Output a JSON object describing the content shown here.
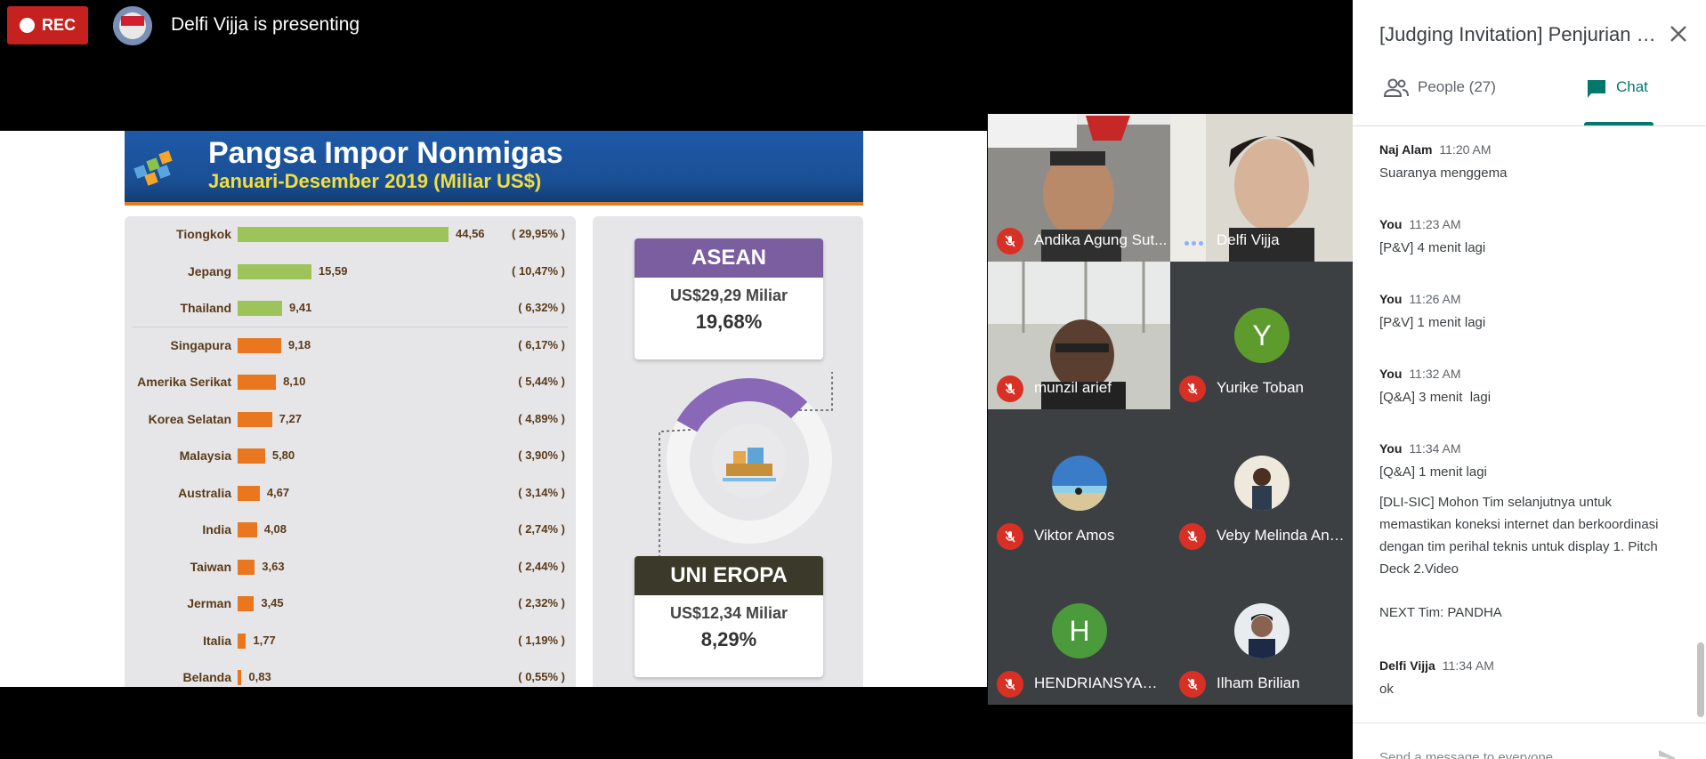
{
  "top_bar": {
    "rec_label": "REC",
    "presenter_text": "Delfi Vijja is presenting"
  },
  "slide": {
    "title": "Pangsa Impor Nonmigas",
    "subtitle": "Januari-Desember 2019 (Miliar US$)",
    "rows": [
      {
        "country": "Tiongkok",
        "value": "44,56",
        "pct": "( 29,95% )",
        "amount": 44.56,
        "color": "#9dc45a"
      },
      {
        "country": "Jepang",
        "value": "15,59",
        "pct": "( 10,47% )",
        "amount": 15.59,
        "color": "#9dc45a"
      },
      {
        "country": "Thailand",
        "value": "9,41",
        "pct": "( 6,32% )",
        "amount": 9.41,
        "color": "#9dc45a"
      },
      {
        "country": "Singapura",
        "value": "9,18",
        "pct": "( 6,17% )",
        "amount": 9.18,
        "color": "#e8771f"
      },
      {
        "country": "Amerika Serikat",
        "value": "8,10",
        "pct": "( 5,44% )",
        "amount": 8.1,
        "color": "#e8771f"
      },
      {
        "country": "Korea Selatan",
        "value": "7,27",
        "pct": "( 4,89% )",
        "amount": 7.27,
        "color": "#e8771f"
      },
      {
        "country": "Malaysia",
        "value": "5,80",
        "pct": "( 3,90% )",
        "amount": 5.8,
        "color": "#e8771f"
      },
      {
        "country": "Australia",
        "value": "4,67",
        "pct": "( 3,14% )",
        "amount": 4.67,
        "color": "#e8771f"
      },
      {
        "country": "India",
        "value": "4,08",
        "pct": "( 2,74% )",
        "amount": 4.08,
        "color": "#e8771f"
      },
      {
        "country": "Taiwan",
        "value": "3,63",
        "pct": "( 2,44% )",
        "amount": 3.63,
        "color": "#e8771f"
      },
      {
        "country": "Jerman",
        "value": "3,45",
        "pct": "( 2,32% )",
        "amount": 3.45,
        "color": "#e8771f"
      },
      {
        "country": "Italia",
        "value": "1,77",
        "pct": "( 1,19% )",
        "amount": 1.77,
        "color": "#e8771f"
      },
      {
        "country": "Belanda",
        "value": "0,83",
        "pct": "( 0,55% )",
        "amount": 0.83,
        "color": "#e8771f"
      }
    ],
    "asean": {
      "label": "ASEAN",
      "amount": "US$29,29 Miliar",
      "pct": "19,68%",
      "color": "#7b5ea0"
    },
    "eu": {
      "label": "UNI EROPA",
      "amount": "US$12,34 Miliar",
      "pct": "8,29%",
      "color": "#3b3a2a"
    }
  },
  "participants": [
    {
      "name": "Andika Agung Sut...",
      "muted": true,
      "kind": "video"
    },
    {
      "name": "Delfi Vijja",
      "muted": false,
      "kind": "video"
    },
    {
      "name": "munzil arief",
      "muted": true,
      "kind": "video"
    },
    {
      "name": "Yurike Toban",
      "muted": true,
      "kind": "letter",
      "letter": "Y",
      "color": "#5e9b2d"
    },
    {
      "name": "Viktor Amos",
      "muted": true,
      "kind": "photo"
    },
    {
      "name": "Veby Melinda Ann...",
      "muted": true,
      "kind": "photo"
    },
    {
      "name": "HENDRIANSYAH ...",
      "muted": true,
      "kind": "letter",
      "letter": "H",
      "color": "#4b9a3b"
    },
    {
      "name": "Ilham Brilian",
      "muted": true,
      "kind": "photo"
    }
  ],
  "side_panel": {
    "meeting_title": "[Judging Invitation] Penjurian Pitching",
    "tab_people": "People (27)",
    "tab_chat": "Chat",
    "composer_placeholder": "Send a message to everyone"
  },
  "chat": [
    {
      "sender": "Naj Alam",
      "time": "11:20 AM",
      "text": "Suaranya menggema"
    },
    {
      "sender": "You",
      "time": "11:23 AM",
      "text": "[P&V] 4 menit lagi"
    },
    {
      "sender": "You",
      "time": "11:26 AM",
      "text": "[P&V] 1 menit lagi"
    },
    {
      "sender": "You",
      "time": "11:32 AM",
      "text": "[Q&A] 3 menit  lagi"
    },
    {
      "sender": "You",
      "time": "11:34 AM",
      "text": "[Q&A] 1 menit lagi"
    },
    {
      "sender": "",
      "time": "",
      "text": "[DLI-SIC] Mohon Tim selanjutnya untuk memastikan koneksi internet dan berkoordinasi dengan tim perihal teknis untuk display 1. Pitch Deck 2.Video"
    },
    {
      "sender": "",
      "time": "",
      "text": "NEXT Tim: PANDHA"
    },
    {
      "sender": "Delfi Vijja",
      "time": "11:34 AM",
      "text": "ok"
    }
  ]
}
